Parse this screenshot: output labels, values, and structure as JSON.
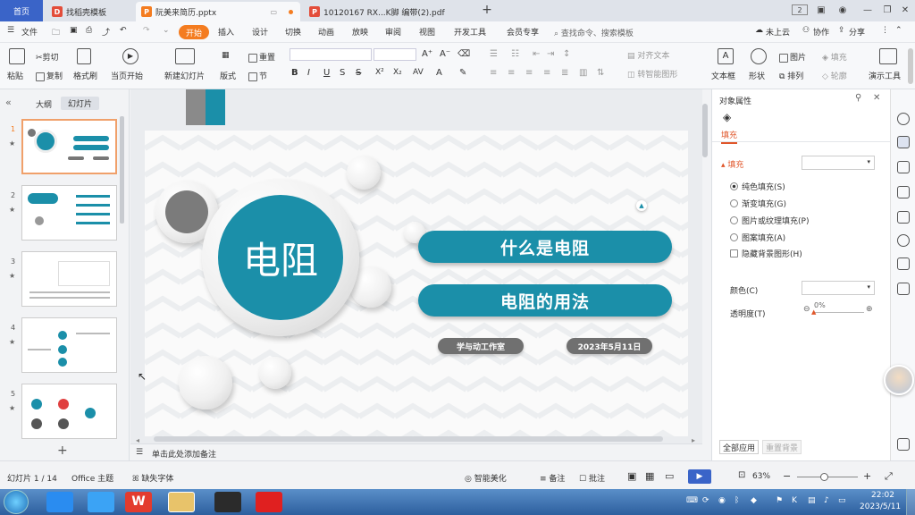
{
  "tabs": {
    "home": "首页",
    "templates": "找稻壳模板",
    "pptx": "阮美来简历.pptx",
    "pdf": "10120167  RX...K脚 编带(2).pdf"
  },
  "menu": {
    "file": "文件",
    "items": [
      "开始",
      "插入",
      "设计",
      "切换",
      "动画",
      "放映",
      "审阅",
      "视图",
      "开发工具",
      "会员专享"
    ],
    "search": "查找命令、搜索模板",
    "cloud": "未上云",
    "collab": "协作",
    "share": "分享"
  },
  "ribbon": {
    "paste": "粘贴",
    "cut": "剪切",
    "copy": "复制",
    "format_painter": "格式刷",
    "start_from_current": "当页开始",
    "new_slide": "新建幻灯片",
    "layout": "版式",
    "section": "节",
    "reset": "重置",
    "align_text": "对齐文本",
    "smart_graphic": "转智能图形",
    "textbox": "文本框",
    "shape": "形状",
    "picture": "图片",
    "arrange": "排列",
    "fill": "填充",
    "outline": "轮廓",
    "presenter_tools": "演示工具"
  },
  "left_panel": {
    "outline_tab": "大纲",
    "slides_tab": "幻灯片",
    "slides": [
      "1",
      "2",
      "3",
      "4",
      "5"
    ],
    "add": "+"
  },
  "slide": {
    "circle_title": "电阻",
    "item1": "什么是电阻",
    "item2": "电阻的用法",
    "studio": "学与动工作室",
    "date": "2023年5月11日"
  },
  "notes_placeholder": "单击此处添加备注",
  "properties": {
    "title": "对象属性",
    "fill_tab": "填充",
    "fill_section": "填充",
    "options": [
      "纯色填充(S)",
      "渐变填充(G)",
      "图片或纹理填充(P)",
      "图案填充(A)"
    ],
    "hide_bg": "隐藏背景图形(H)",
    "color_label": "颜色(C)",
    "transparency_label": "透明度(T)",
    "transparency_value": "0%",
    "apply_all": "全部应用",
    "reset_bg": "重置背景"
  },
  "status": {
    "slide_info": "幻灯片 1 / 14",
    "theme": "Office 主题",
    "missing_font": "缺失字体",
    "smart_beautify": "智能美化",
    "notes": "备注",
    "comments": "批注",
    "zoom": "63%"
  },
  "taskbar": {
    "time": "22:02",
    "date": "2023/5/11"
  },
  "colors": {
    "teal": "#1b8fa9",
    "accent_orange": "#f47c20",
    "tab_blue": "#3a64c8"
  }
}
